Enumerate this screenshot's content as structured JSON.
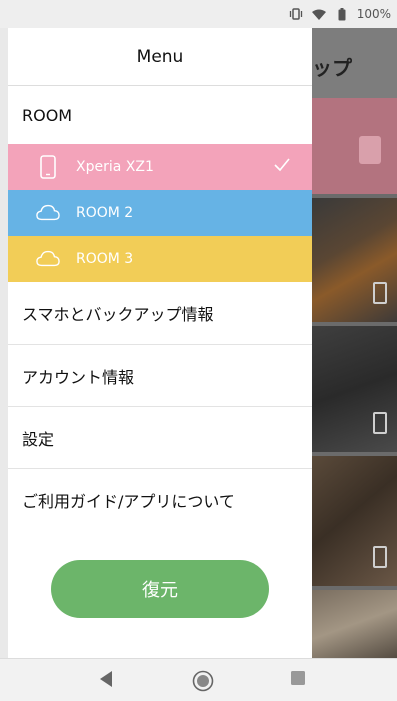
{
  "status_bar": {
    "battery_text": "100%"
  },
  "background_app": {
    "title_fragment": "ップ"
  },
  "drawer": {
    "title": "Menu",
    "rooms_label": "ROOM",
    "rooms": [
      {
        "label": "Xperia XZ1",
        "icon": "phone-icon",
        "color": "#f3a3ba",
        "selected": true
      },
      {
        "label": "ROOM 2",
        "icon": "cloud-icon",
        "color": "#66b3e5",
        "selected": false
      },
      {
        "label": "ROOM 3",
        "icon": "cloud-icon",
        "color": "#f2cd57",
        "selected": false
      }
    ],
    "menu_items": [
      "スマホとバックアップ情報",
      "アカウント情報",
      "設定",
      "ご利用ガイド/アプリについて"
    ],
    "restore_label": "復元"
  },
  "colors": {
    "accent_green": "#6cb56a"
  }
}
